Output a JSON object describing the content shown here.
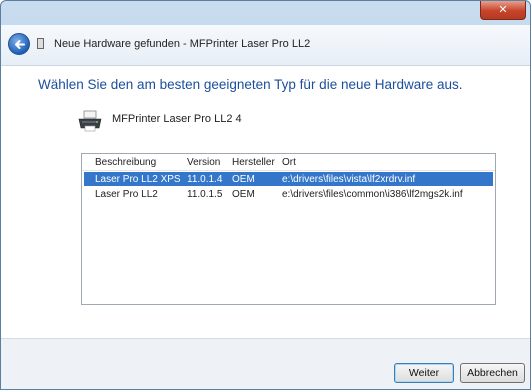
{
  "window": {
    "close_label": "✕"
  },
  "nav": {
    "title": "Neue Hardware gefunden - MFPrinter Laser Pro LL2"
  },
  "main": {
    "heading": "Wählen Sie den am besten geeigneten Typ für die neue Hardware aus.",
    "device_name": "MFPrinter Laser Pro LL2 4"
  },
  "list": {
    "columns": [
      "Beschreibung",
      "Version",
      "Hersteller",
      "Ort"
    ],
    "rows": [
      {
        "beschreibung": "Laser Pro LL2 XPS",
        "version": "11.0.1.4",
        "hersteller": "OEM",
        "ort": "e:\\drivers\\files\\vista\\lf2xrdrv.inf",
        "selected": true
      },
      {
        "beschreibung": "Laser Pro LL2",
        "version": "11.0.1.5",
        "hersteller": "OEM",
        "ort": "e:\\drivers\\files\\common\\i386\\lf2mgs2k.inf",
        "selected": false
      }
    ]
  },
  "buttons": {
    "next": "Weiter",
    "cancel": "Abbrechen"
  },
  "colors": {
    "heading": "#1b4f9c",
    "selection": "#3476c9",
    "close_button": "#c7432a"
  },
  "icons": {
    "back": "back-arrow-icon",
    "device": "printer-icon",
    "nav": "hardware-icon",
    "close": "close-icon"
  }
}
